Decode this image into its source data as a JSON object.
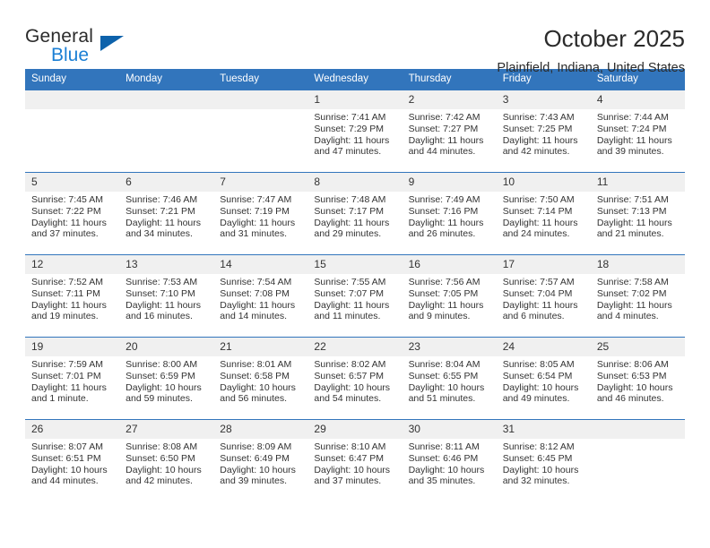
{
  "brand": {
    "name_part1": "General",
    "name_part2": "Blue",
    "accent_color": "#1b7fd4",
    "triangle_color": "#0d62ab"
  },
  "header": {
    "title": "October 2025",
    "subtitle": "Plainfield, Indiana, United States",
    "header_bg_color": "#3275bc",
    "daynum_bg_color": "#f0f0f0"
  },
  "weekday_headers": [
    "Sunday",
    "Monday",
    "Tuesday",
    "Wednesday",
    "Thursday",
    "Friday",
    "Saturday"
  ],
  "labels": {
    "sunrise": "Sunrise:",
    "sunset": "Sunset:",
    "daylight": "Daylight:"
  },
  "weeks": [
    [
      {
        "day": "",
        "sunrise": "",
        "sunset": "",
        "daylight_1": "",
        "daylight_2": ""
      },
      {
        "day": "",
        "sunrise": "",
        "sunset": "",
        "daylight_1": "",
        "daylight_2": ""
      },
      {
        "day": "",
        "sunrise": "",
        "sunset": "",
        "daylight_1": "",
        "daylight_2": ""
      },
      {
        "day": "1",
        "sunrise": "Sunrise: 7:41 AM",
        "sunset": "Sunset: 7:29 PM",
        "daylight_1": "Daylight: 11 hours",
        "daylight_2": "and 47 minutes."
      },
      {
        "day": "2",
        "sunrise": "Sunrise: 7:42 AM",
        "sunset": "Sunset: 7:27 PM",
        "daylight_1": "Daylight: 11 hours",
        "daylight_2": "and 44 minutes."
      },
      {
        "day": "3",
        "sunrise": "Sunrise: 7:43 AM",
        "sunset": "Sunset: 7:25 PM",
        "daylight_1": "Daylight: 11 hours",
        "daylight_2": "and 42 minutes."
      },
      {
        "day": "4",
        "sunrise": "Sunrise: 7:44 AM",
        "sunset": "Sunset: 7:24 PM",
        "daylight_1": "Daylight: 11 hours",
        "daylight_2": "and 39 minutes."
      }
    ],
    [
      {
        "day": "5",
        "sunrise": "Sunrise: 7:45 AM",
        "sunset": "Sunset: 7:22 PM",
        "daylight_1": "Daylight: 11 hours",
        "daylight_2": "and 37 minutes."
      },
      {
        "day": "6",
        "sunrise": "Sunrise: 7:46 AM",
        "sunset": "Sunset: 7:21 PM",
        "daylight_1": "Daylight: 11 hours",
        "daylight_2": "and 34 minutes."
      },
      {
        "day": "7",
        "sunrise": "Sunrise: 7:47 AM",
        "sunset": "Sunset: 7:19 PM",
        "daylight_1": "Daylight: 11 hours",
        "daylight_2": "and 31 minutes."
      },
      {
        "day": "8",
        "sunrise": "Sunrise: 7:48 AM",
        "sunset": "Sunset: 7:17 PM",
        "daylight_1": "Daylight: 11 hours",
        "daylight_2": "and 29 minutes."
      },
      {
        "day": "9",
        "sunrise": "Sunrise: 7:49 AM",
        "sunset": "Sunset: 7:16 PM",
        "daylight_1": "Daylight: 11 hours",
        "daylight_2": "and 26 minutes."
      },
      {
        "day": "10",
        "sunrise": "Sunrise: 7:50 AM",
        "sunset": "Sunset: 7:14 PM",
        "daylight_1": "Daylight: 11 hours",
        "daylight_2": "and 24 minutes."
      },
      {
        "day": "11",
        "sunrise": "Sunrise: 7:51 AM",
        "sunset": "Sunset: 7:13 PM",
        "daylight_1": "Daylight: 11 hours",
        "daylight_2": "and 21 minutes."
      }
    ],
    [
      {
        "day": "12",
        "sunrise": "Sunrise: 7:52 AM",
        "sunset": "Sunset: 7:11 PM",
        "daylight_1": "Daylight: 11 hours",
        "daylight_2": "and 19 minutes."
      },
      {
        "day": "13",
        "sunrise": "Sunrise: 7:53 AM",
        "sunset": "Sunset: 7:10 PM",
        "daylight_1": "Daylight: 11 hours",
        "daylight_2": "and 16 minutes."
      },
      {
        "day": "14",
        "sunrise": "Sunrise: 7:54 AM",
        "sunset": "Sunset: 7:08 PM",
        "daylight_1": "Daylight: 11 hours",
        "daylight_2": "and 14 minutes."
      },
      {
        "day": "15",
        "sunrise": "Sunrise: 7:55 AM",
        "sunset": "Sunset: 7:07 PM",
        "daylight_1": "Daylight: 11 hours",
        "daylight_2": "and 11 minutes."
      },
      {
        "day": "16",
        "sunrise": "Sunrise: 7:56 AM",
        "sunset": "Sunset: 7:05 PM",
        "daylight_1": "Daylight: 11 hours",
        "daylight_2": "and 9 minutes."
      },
      {
        "day": "17",
        "sunrise": "Sunrise: 7:57 AM",
        "sunset": "Sunset: 7:04 PM",
        "daylight_1": "Daylight: 11 hours",
        "daylight_2": "and 6 minutes."
      },
      {
        "day": "18",
        "sunrise": "Sunrise: 7:58 AM",
        "sunset": "Sunset: 7:02 PM",
        "daylight_1": "Daylight: 11 hours",
        "daylight_2": "and 4 minutes."
      }
    ],
    [
      {
        "day": "19",
        "sunrise": "Sunrise: 7:59 AM",
        "sunset": "Sunset: 7:01 PM",
        "daylight_1": "Daylight: 11 hours",
        "daylight_2": "and 1 minute."
      },
      {
        "day": "20",
        "sunrise": "Sunrise: 8:00 AM",
        "sunset": "Sunset: 6:59 PM",
        "daylight_1": "Daylight: 10 hours",
        "daylight_2": "and 59 minutes."
      },
      {
        "day": "21",
        "sunrise": "Sunrise: 8:01 AM",
        "sunset": "Sunset: 6:58 PM",
        "daylight_1": "Daylight: 10 hours",
        "daylight_2": "and 56 minutes."
      },
      {
        "day": "22",
        "sunrise": "Sunrise: 8:02 AM",
        "sunset": "Sunset: 6:57 PM",
        "daylight_1": "Daylight: 10 hours",
        "daylight_2": "and 54 minutes."
      },
      {
        "day": "23",
        "sunrise": "Sunrise: 8:04 AM",
        "sunset": "Sunset: 6:55 PM",
        "daylight_1": "Daylight: 10 hours",
        "daylight_2": "and 51 minutes."
      },
      {
        "day": "24",
        "sunrise": "Sunrise: 8:05 AM",
        "sunset": "Sunset: 6:54 PM",
        "daylight_1": "Daylight: 10 hours",
        "daylight_2": "and 49 minutes."
      },
      {
        "day": "25",
        "sunrise": "Sunrise: 8:06 AM",
        "sunset": "Sunset: 6:53 PM",
        "daylight_1": "Daylight: 10 hours",
        "daylight_2": "and 46 minutes."
      }
    ],
    [
      {
        "day": "26",
        "sunrise": "Sunrise: 8:07 AM",
        "sunset": "Sunset: 6:51 PM",
        "daylight_1": "Daylight: 10 hours",
        "daylight_2": "and 44 minutes."
      },
      {
        "day": "27",
        "sunrise": "Sunrise: 8:08 AM",
        "sunset": "Sunset: 6:50 PM",
        "daylight_1": "Daylight: 10 hours",
        "daylight_2": "and 42 minutes."
      },
      {
        "day": "28",
        "sunrise": "Sunrise: 8:09 AM",
        "sunset": "Sunset: 6:49 PM",
        "daylight_1": "Daylight: 10 hours",
        "daylight_2": "and 39 minutes."
      },
      {
        "day": "29",
        "sunrise": "Sunrise: 8:10 AM",
        "sunset": "Sunset: 6:47 PM",
        "daylight_1": "Daylight: 10 hours",
        "daylight_2": "and 37 minutes."
      },
      {
        "day": "30",
        "sunrise": "Sunrise: 8:11 AM",
        "sunset": "Sunset: 6:46 PM",
        "daylight_1": "Daylight: 10 hours",
        "daylight_2": "and 35 minutes."
      },
      {
        "day": "31",
        "sunrise": "Sunrise: 8:12 AM",
        "sunset": "Sunset: 6:45 PM",
        "daylight_1": "Daylight: 10 hours",
        "daylight_2": "and 32 minutes."
      },
      {
        "day": "",
        "sunrise": "",
        "sunset": "",
        "daylight_1": "",
        "daylight_2": ""
      }
    ]
  ]
}
